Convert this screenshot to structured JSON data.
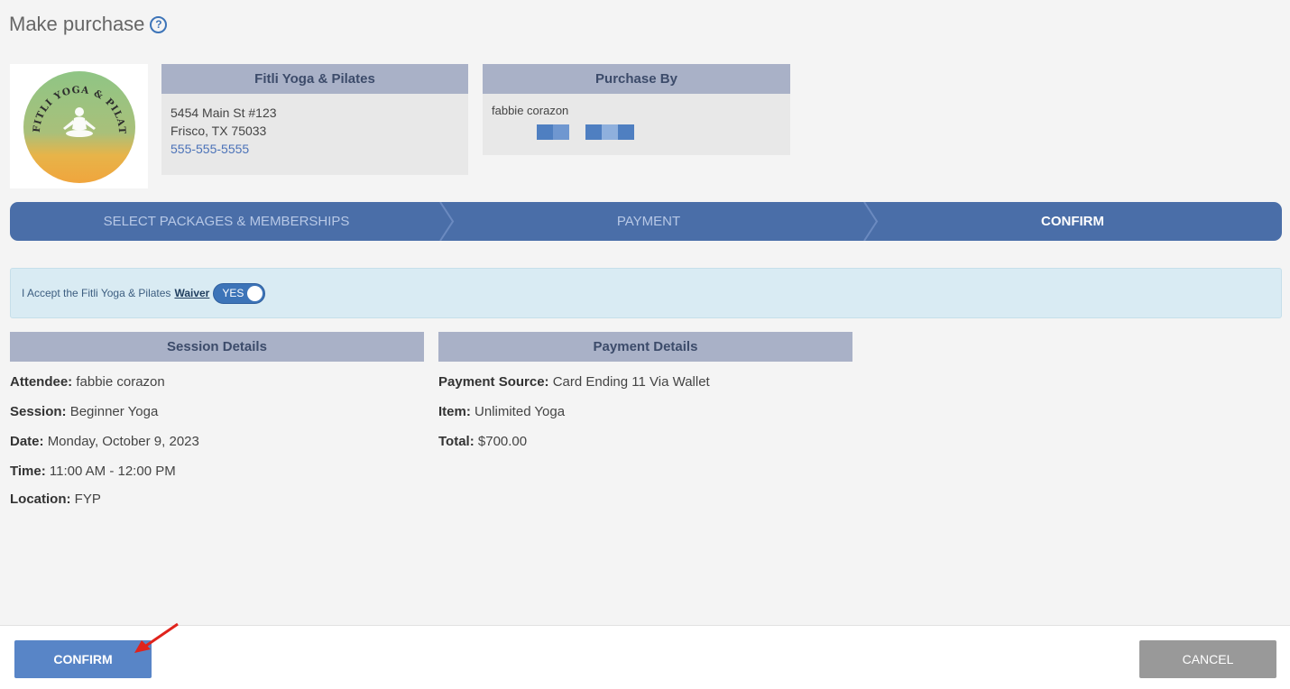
{
  "header": {
    "title": "Make purchase",
    "help_icon": "help-circle-icon"
  },
  "business": {
    "logo_text": "FITLI YOGA & PILATES",
    "name": "Fitli Yoga & Pilates",
    "address_line1": "5454 Main St #123",
    "address_line2": "Frisco, TX 75033",
    "phone": "555-555-5555"
  },
  "purchase_by": {
    "heading": "Purchase By",
    "name": "fabbie corazon"
  },
  "steps": [
    {
      "label": "SELECT PACKAGES & MEMBERSHIPS",
      "active": false
    },
    {
      "label": "PAYMENT",
      "active": false
    },
    {
      "label": "CONFIRM",
      "active": true
    }
  ],
  "waiver": {
    "text": "I Accept the Fitli Yoga & Pilates",
    "link": "Waiver",
    "toggle_label": "YES",
    "toggle_on": true
  },
  "session_details": {
    "heading": "Session Details",
    "attendee_label": "Attendee:",
    "attendee": "fabbie corazon",
    "session_label": "Session:",
    "session": "Beginner Yoga",
    "date_label": "Date:",
    "date": "Monday, October 9, 2023",
    "time_label": "Time:",
    "time": "11:00 AM - 12:00 PM",
    "location_label": "Location:",
    "location": "FYP"
  },
  "payment_details": {
    "heading": "Payment Details",
    "source_label": "Payment Source:",
    "source": "Card Ending 11 Via Wallet",
    "item_label": "Item:",
    "item": "Unlimited Yoga",
    "total_label": "Total:",
    "total": "$700.00"
  },
  "footer": {
    "confirm_label": "CONFIRM",
    "cancel_label": "CANCEL"
  },
  "colors": {
    "accent": "#4a6ea8",
    "button_primary": "#5885c7",
    "button_cancel": "#999999",
    "waiver_bg": "#d9ebf3",
    "section_head": "#a9b1c7"
  }
}
